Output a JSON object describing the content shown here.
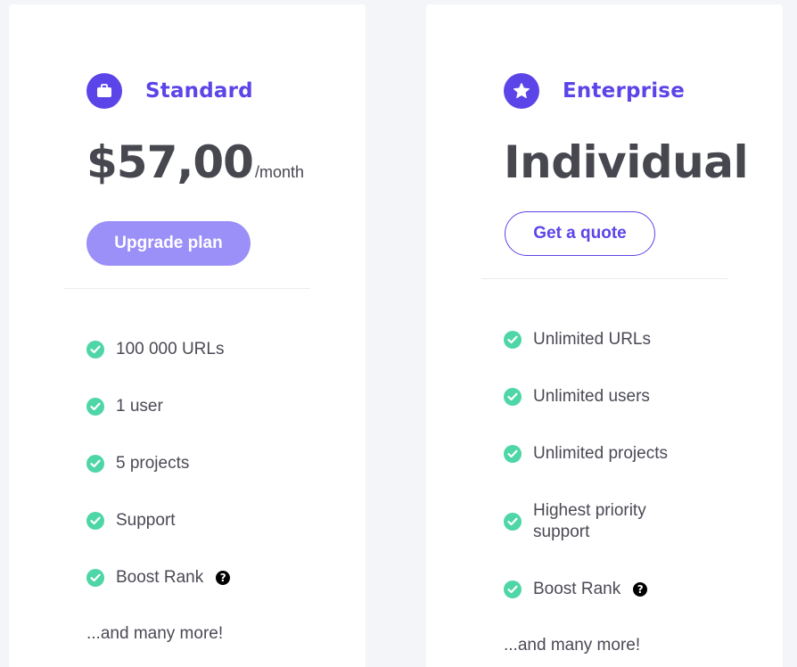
{
  "plans": {
    "standard": {
      "icon": "briefcase-icon",
      "name": "Standard",
      "price": "$57,00",
      "price_unit": "/month",
      "button_label": "Upgrade plan",
      "features": [
        {
          "text": "100 000 URLs"
        },
        {
          "text": "1 user"
        },
        {
          "text": "5 projects"
        },
        {
          "text": "Support"
        },
        {
          "text": "Boost Rank",
          "help": "?"
        }
      ],
      "more": "...and many more!"
    },
    "enterprise": {
      "icon": "star-icon",
      "name": "Enterprise",
      "price": "Individual",
      "button_label": "Get a quote",
      "features": [
        {
          "text": "Unlimited URLs"
        },
        {
          "text": "Unlimited users"
        },
        {
          "text": "Unlimited projects"
        },
        {
          "text": "Highest priority support"
        },
        {
          "text": "Boost Rank",
          "help": "?"
        }
      ],
      "more": "...and many more!"
    }
  },
  "colors": {
    "accent": "#5b45e8",
    "button_soft": "#9b8ff8",
    "check": "#4ed6a6",
    "text": "#4a4a55",
    "background": "#f4f5f8"
  }
}
